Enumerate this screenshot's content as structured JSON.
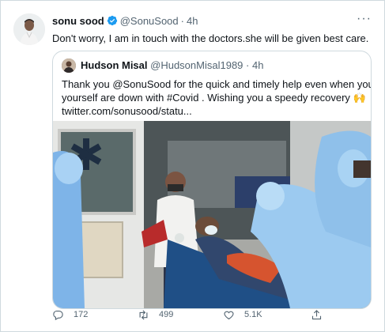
{
  "tweet": {
    "author_name": "sonu sood",
    "handle": "@SonuSood",
    "separator": "·",
    "time": "4h",
    "more_label": "···",
    "text": "Don't worry, I am in touch with the doctors.she will be given best care."
  },
  "quote": {
    "author_name": "Hudson Misal",
    "handle": "@HudsonMisal1989",
    "separator": "·",
    "time": "4h",
    "lines": [
      "Thank you @SonuSood for the quick and  timely help even when you",
      "yourself are down with #Covid . Wishing you a speedy recovery 🙌",
      "twitter.com/sonusood/statu..."
    ]
  },
  "actions": {
    "replies": "172",
    "retweets": "499",
    "likes": "5.1K"
  },
  "colors": {
    "text": "#0f1419",
    "muted": "#536471",
    "verified": "#1d9bf0",
    "border": "#cfd9de"
  },
  "icons": [
    "verified-badge-icon",
    "more-icon",
    "reply-icon",
    "retweet-icon",
    "like-icon",
    "share-icon"
  ]
}
